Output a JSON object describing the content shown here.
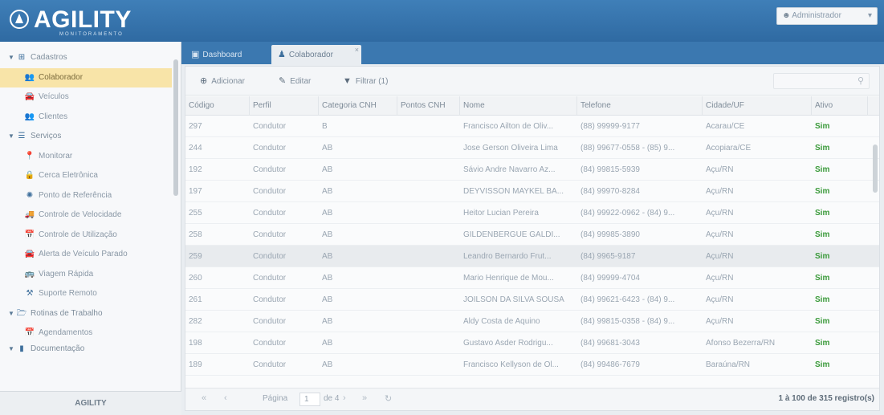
{
  "app": {
    "logo_text": "AGILITY",
    "logo_subtext": "MONITORAMENTO",
    "footer_label": "AGILITY"
  },
  "user": {
    "name": "Administrador",
    "icon": "user-icon"
  },
  "tabs": [
    {
      "label": "Dashboard",
      "icon": "monitor-icon"
    },
    {
      "label": "Colaborador",
      "icon": "users-icon",
      "close": "×"
    }
  ],
  "sidebar": {
    "items": [
      {
        "label": "Cadastros",
        "icon": "plus-square-icon",
        "glyph": "⊞",
        "caret": "▼"
      },
      {
        "label": "Colaborador",
        "icon": "users-icon",
        "glyph": "👥"
      },
      {
        "label": "Veículos",
        "icon": "car-icon",
        "glyph": "🚘"
      },
      {
        "label": "Clientes",
        "icon": "clients-icon",
        "glyph": "👥"
      },
      {
        "label": "Serviços",
        "icon": "list-icon",
        "glyph": "☰",
        "caret": "▼"
      },
      {
        "label": "Monitorar",
        "icon": "map-pin-icon",
        "glyph": "📍"
      },
      {
        "label": "Cerca Eletrônica",
        "icon": "lock-icon",
        "glyph": "🔒"
      },
      {
        "label": "Ponto de Referência",
        "icon": "target-icon",
        "glyph": "✺"
      },
      {
        "label": "Controle de Velocidade",
        "icon": "speed-icon",
        "glyph": "🚚"
      },
      {
        "label": "Controle de Utilização",
        "icon": "calendar-icon",
        "glyph": "📅"
      },
      {
        "label": "Alerta de Veículo Parado",
        "icon": "car-icon",
        "glyph": "🚘"
      },
      {
        "label": "Viagem Rápida",
        "icon": "bus-icon",
        "glyph": "🚌"
      },
      {
        "label": "Suporte Remoto",
        "icon": "support-icon",
        "glyph": "⚒"
      },
      {
        "label": "Rotinas de Trabalho",
        "icon": "folder-icon",
        "glyph": "🗁",
        "caret": "▼"
      },
      {
        "label": "Agendamentos",
        "icon": "calendar-icon",
        "glyph": "📅"
      },
      {
        "label": "Documentação",
        "icon": "doc-icon",
        "glyph": "▮",
        "caret": "▼"
      }
    ]
  },
  "toolbar": {
    "add_label": "Adicionar",
    "add_icon": "plus-circle-icon",
    "edit_label": "Editar",
    "edit_icon": "pencil-icon",
    "filter_label": "Filtrar (1)",
    "filter_icon": "filter-icon",
    "search_icon": "search-icon"
  },
  "table": {
    "columns": [
      "Código",
      "Perfil",
      "Categoria CNH",
      "Pontos CNH",
      "Nome",
      "Telefone",
      "Cidade/UF",
      "Ativo"
    ],
    "rows": [
      [
        "297",
        "Condutor",
        "B",
        "",
        "Francisco Ailton de Oliv...",
        "(88) 99999-9177",
        "Acarau/CE",
        "Sim"
      ],
      [
        "244",
        "Condutor",
        "AB",
        "",
        "Jose Gerson Oliveira Lima",
        "(88) 99677-0558 - (85) 9...",
        "Acopiara/CE",
        "Sim"
      ],
      [
        "192",
        "Condutor",
        "AB",
        "",
        "Sávio Andre Navarro Az...",
        "(84) 99815-5939",
        "Açu/RN",
        "Sim"
      ],
      [
        "197",
        "Condutor",
        "AB",
        "",
        "DEYVISSON MAYKEL BA...",
        "(84) 99970-8284",
        "Açu/RN",
        "Sim"
      ],
      [
        "255",
        "Condutor",
        "AB",
        "",
        "Heitor Lucian Pereira",
        "(84) 99922-0962 - (84) 9...",
        "Açu/RN",
        "Sim"
      ],
      [
        "258",
        "Condutor",
        "AB",
        "",
        "GILDENBERGUE GALDI...",
        "(84) 99985-3890",
        "Açu/RN",
        "Sim"
      ],
      [
        "259",
        "Condutor",
        "AB",
        "",
        "Leandro Bernardo Frut...",
        "(84) 9965-9187",
        "Açu/RN",
        "Sim"
      ],
      [
        "260",
        "Condutor",
        "AB",
        "",
        "Mario Henrique de Mou...",
        "(84) 99999-4704",
        "Açu/RN",
        "Sim"
      ],
      [
        "261",
        "Condutor",
        "AB",
        "",
        "JOILSON DA SILVA SOUSA",
        "(84) 99621-6423 - (84) 9...",
        "Açu/RN",
        "Sim"
      ],
      [
        "282",
        "Condutor",
        "AB",
        "",
        "Aldy Costa de Aquino",
        "(84) 99815-0358 - (84) 9...",
        "Açu/RN",
        "Sim"
      ],
      [
        "198",
        "Condutor",
        "AB",
        "",
        "Gustavo Asder Rodrigu...",
        "(84) 99681-3043",
        "Afonso Bezerra/RN",
        "Sim"
      ],
      [
        "189",
        "Condutor",
        "AB",
        "",
        "Francisco Kellyson de Ol...",
        "(84) 99486-7679",
        "Baraúna/RN",
        "Sim"
      ]
    ]
  },
  "pager": {
    "page_label": "Página",
    "page_value": "1",
    "of_label": "de 4",
    "info": "1 à 100 de 315 registro(s)",
    "first_icon": "first-page-icon",
    "prev_icon": "prev-page-icon",
    "next_icon": "next-page-icon",
    "last_icon": "last-page-icon",
    "refresh_icon": "refresh-icon"
  }
}
